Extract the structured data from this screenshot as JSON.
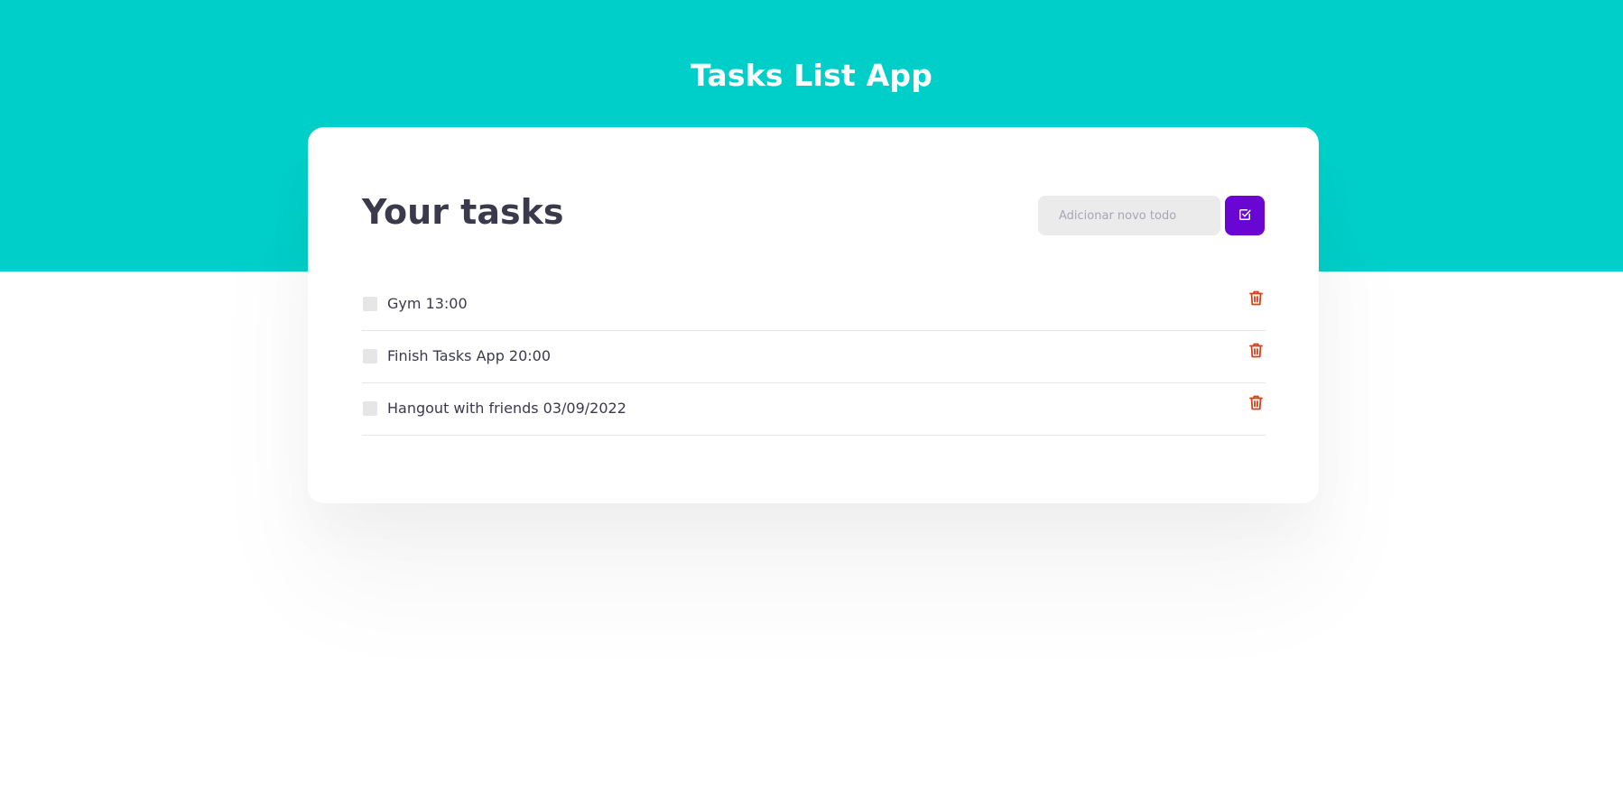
{
  "header": {
    "title": "Tasks List App",
    "background_color": "#00cfc9"
  },
  "card": {
    "title": "Your tasks",
    "new_todo": {
      "placeholder": "Adicionar novo todo",
      "value": ""
    },
    "add_button": {
      "icon": "checkbox-check-icon",
      "color": "#6a06d3"
    }
  },
  "tasks": [
    {
      "label": "Gym 13:00",
      "checked": false,
      "delete_icon": "trash-icon"
    },
    {
      "label": "Finish Tasks App 20:00",
      "checked": false,
      "delete_icon": "trash-icon"
    },
    {
      "label": "Hangout with friends 03/09/2022",
      "checked": false,
      "delete_icon": "trash-icon"
    }
  ],
  "colors": {
    "delete_icon": "#d6401a",
    "text": "#3a3a4c"
  }
}
